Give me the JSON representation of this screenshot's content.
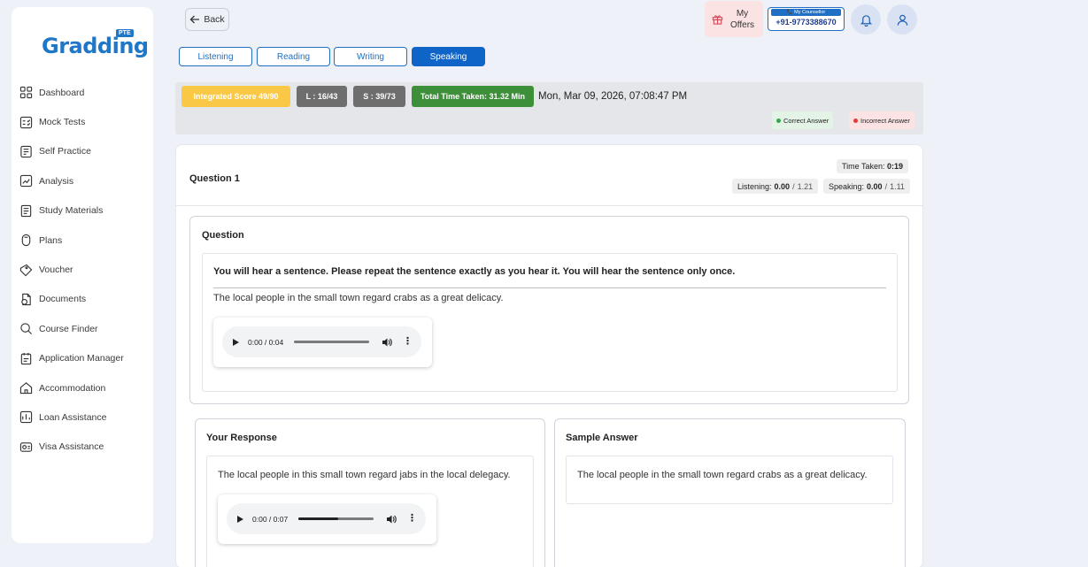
{
  "brand": {
    "name": "Gradding",
    "badge": "PTE"
  },
  "sidebar": {
    "items": [
      {
        "label": "Dashboard",
        "icon": "dashboard-icon"
      },
      {
        "label": "Mock Tests",
        "icon": "mock-tests-icon"
      },
      {
        "label": "Self Practice",
        "icon": "self-practice-icon"
      },
      {
        "label": "Analysis",
        "icon": "analysis-icon"
      },
      {
        "label": "Study Materials",
        "icon": "study-materials-icon"
      },
      {
        "label": "Plans",
        "icon": "plans-icon"
      },
      {
        "label": "Voucher",
        "icon": "voucher-icon"
      },
      {
        "label": "Documents",
        "icon": "documents-icon"
      },
      {
        "label": "Course Finder",
        "icon": "course-finder-icon"
      },
      {
        "label": "Application Manager",
        "icon": "application-manager-icon"
      },
      {
        "label": "Accommodation",
        "icon": "accommodation-icon"
      },
      {
        "label": "Loan Assistance",
        "icon": "loan-assistance-icon"
      },
      {
        "label": "Visa Assistance",
        "icon": "visa-assistance-icon"
      }
    ]
  },
  "topbar": {
    "back_label": "Back",
    "offers_line1": "My",
    "offers_line2": "Offers",
    "counsellor_label": "📞 My Counsellor",
    "counsellor_phone": "+91-9773388670"
  },
  "tabs": [
    {
      "label": "Listening",
      "active": false
    },
    {
      "label": "Reading",
      "active": false
    },
    {
      "label": "Writing",
      "active": false
    },
    {
      "label": "Speaking",
      "active": true
    }
  ],
  "scores": {
    "integrated": "Integrated Score 49/90",
    "listening": "L : 16/43",
    "speaking": "S : 39/73",
    "total_time": "Total Time Taken: 31.32 Min",
    "datetime": "Mon, Mar 09, 2026, 07:08:47 PM",
    "correct_label": "Correct Answer",
    "incorrect_label": "Incorrect Answer"
  },
  "colors": {
    "integrated": "#f9c847",
    "gray_badge": "#6e6e6e",
    "green_badge": "#3e8f3a",
    "accent": "#0e64c7",
    "correct_bg": "#e3f3e6",
    "correct_dot": "#2ea84a",
    "incorrect_bg": "#fbe3e3",
    "incorrect_dot": "#e23b3b"
  },
  "question": {
    "title": "Question 1",
    "time_taken_label": "Time Taken:",
    "time_taken_value": "0:19",
    "listening_label": "Listening:",
    "listening_score": "0.00",
    "listening_total": "1.21",
    "speaking_label": "Speaking:",
    "speaking_score": "0.00",
    "speaking_total": "1.11",
    "section_head": "Question",
    "instruction": "You will hear a sentence. Please repeat the sentence exactly as you hear it. You will hear the sentence only once.",
    "sentence": "The local people in the small town regard crabs as a great delicacy.",
    "audio_time": "0:00 / 0:04",
    "audio_progress": 0
  },
  "response": {
    "head": "Your Response",
    "text": "The local people in this small town regard jabs in the local delegacy.",
    "audio_time": "0:00 / 0:07",
    "audio_progress": 0.53
  },
  "sample": {
    "head": "Sample Answer",
    "text": "The local people in the small town regard crabs as a great delicacy."
  }
}
